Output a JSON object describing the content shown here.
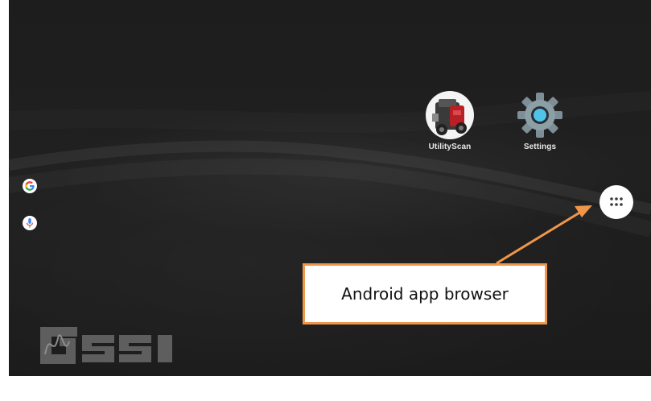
{
  "home": {
    "apps": [
      {
        "label": "UtilityScan",
        "icon": "utilityscan-icon"
      },
      {
        "label": "Settings",
        "icon": "gear-icon"
      }
    ],
    "side_buttons": [
      {
        "icon": "google-icon"
      },
      {
        "icon": "microphone-icon"
      }
    ],
    "app_drawer_icon": "app-drawer-icon",
    "wallpaper_logo": "GSSI"
  },
  "annotation": {
    "callout_text": "Android app browser",
    "color": "#f0964a"
  }
}
